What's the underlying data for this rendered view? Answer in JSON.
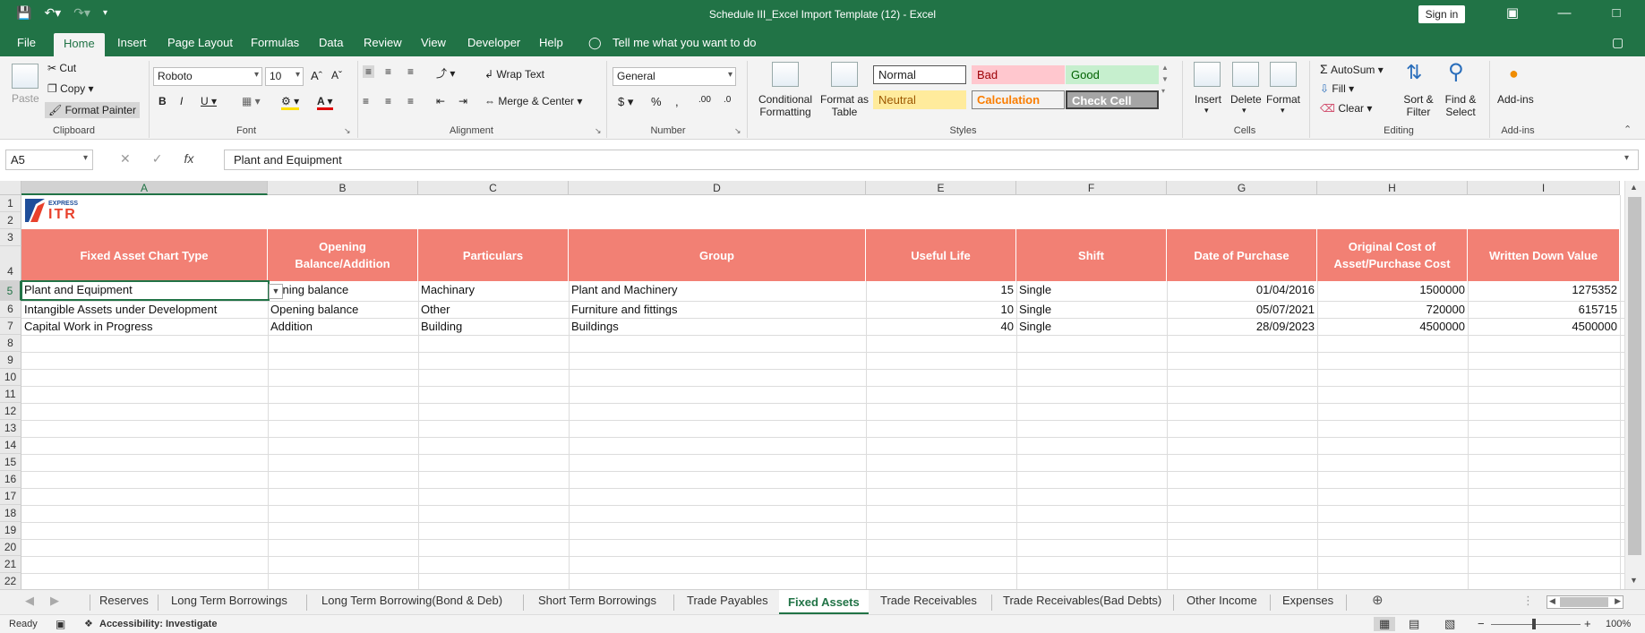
{
  "window": {
    "title": "Schedule III_Excel Import Template (12)  -  Excel",
    "sign_in": "Sign in"
  },
  "menu": {
    "tabs": [
      "File",
      "Home",
      "Insert",
      "Page Layout",
      "Formulas",
      "Data",
      "Review",
      "View",
      "Developer",
      "Help"
    ],
    "active": "Home",
    "tell_me": "Tell me what you want to do"
  },
  "ribbon": {
    "clipboard": {
      "paste": "Paste",
      "cut": "Cut",
      "copy": "Copy",
      "format_painter": "Format Painter",
      "label": "Clipboard"
    },
    "font": {
      "name": "Roboto",
      "size": "10",
      "label": "Font"
    },
    "alignment": {
      "wrap_text": "Wrap Text",
      "merge_center": "Merge & Center",
      "label": "Alignment"
    },
    "number": {
      "format": "General",
      "label": "Number"
    },
    "styles": {
      "conditional": "Conditional Formatting",
      "format_table": "Format as Table",
      "normal": "Normal",
      "bad": "Bad",
      "good": "Good",
      "neutral": "Neutral",
      "calculation": "Calculation",
      "check_cell": "Check Cell",
      "label": "Styles"
    },
    "cells": {
      "insert": "Insert",
      "delete": "Delete",
      "format": "Format",
      "label": "Cells"
    },
    "editing": {
      "autosum": "AutoSum",
      "fill": "Fill",
      "clear": "Clear",
      "sort_filter": "Sort & Filter",
      "find_select": "Find & Select",
      "label": "Editing"
    },
    "addins": {
      "addins": "Add-ins",
      "label": "Add-ins"
    }
  },
  "formula_bar": {
    "name_box": "A5",
    "formula": "Plant and Equipment"
  },
  "logo": {
    "text_top": "EXPRESS",
    "text_main": "ITR"
  },
  "columns": [
    "A",
    "B",
    "C",
    "D",
    "E",
    "F",
    "G",
    "H",
    "I"
  ],
  "headers": {
    "a": "Fixed Asset Chart Type",
    "b": "Opening Balance/Addition",
    "c": "Particulars",
    "d": "Group",
    "e": "Useful Life",
    "f": "Shift",
    "g": "Date of Purchase",
    "h": "Original Cost of Asset/Purchase Cost",
    "i": "Written Down Value"
  },
  "rows": [
    {
      "a": "Plant and Equipment",
      "b": "pening balance",
      "c": "Machinary",
      "d": "Plant and Machinery",
      "e": "15",
      "f": "Single",
      "g": "01/04/2016",
      "h": "1500000",
      "i": "1275352"
    },
    {
      "a": "Intangible Assets under Development",
      "b": "Opening balance",
      "c": "Other",
      "d": "Furniture and fittings",
      "e": "10",
      "f": "Single",
      "g": "05/07/2021",
      "h": "720000",
      "i": "615715"
    },
    {
      "a": "Capital Work in Progress",
      "b": "Addition",
      "c": "Building",
      "d": "Buildings",
      "e": "40",
      "f": "Single",
      "g": "28/09/2023",
      "h": "4500000",
      "i": "4500000"
    }
  ],
  "row_numbers": [
    "1",
    "2",
    "3",
    "4",
    "5",
    "6",
    "7",
    "8",
    "9",
    "10",
    "11",
    "12",
    "13",
    "14",
    "15",
    "16",
    "17",
    "18",
    "19",
    "20",
    "21",
    "22"
  ],
  "sheets": [
    "Reserves",
    "Long Term Borrowings",
    "Long Term Borrowing(Bond & Deb)",
    "Short Term Borrowings",
    "Trade Payables",
    "Fixed Assets",
    "Trade Receivables",
    "Trade Receivables(Bad Debts)",
    "Other Income",
    "Expenses"
  ],
  "active_sheet": "Fixed Assets",
  "status": {
    "ready": "Ready",
    "accessibility": "Accessibility: Investigate",
    "zoom": "100%"
  },
  "colors": {
    "excel_green": "#217346",
    "header_fill": "#f28074"
  }
}
